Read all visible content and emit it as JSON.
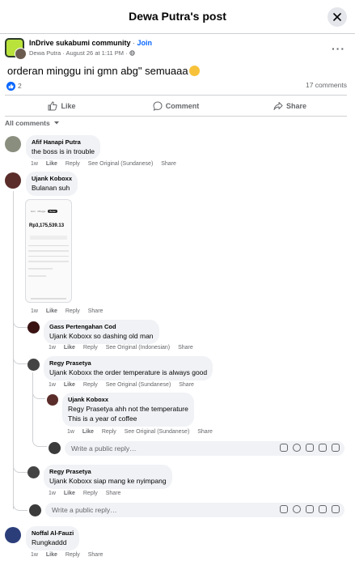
{
  "header": {
    "title": "Dewa Putra's post"
  },
  "post": {
    "group_name": "InDrive sukabumi community",
    "join_label": "Join",
    "author": "Dewa Putra",
    "timestamp": "August 26 at 1:11 PM",
    "text": "orderan minggu ini gmn abg\" semuaaa",
    "like_count": "2",
    "comment_count": "17 comments"
  },
  "actions": {
    "like": "Like",
    "comment": "Comment",
    "share": "Share"
  },
  "sort_label": "All comments",
  "comment_actions": {
    "like": "Like",
    "reply": "Reply",
    "share": "Share",
    "see_original_sundanese": "See Original (Sundanese)",
    "see_original_indonesian": "See Original (Indonesian)"
  },
  "comments": [
    {
      "author": "Afif Hanapi Putra",
      "text": "the boss is in trouble",
      "time": "1w"
    },
    {
      "author": "Ujank Koboxx",
      "text": "Bulanan suh",
      "time": "1w",
      "photo": {
        "tabs": [
          "Hari",
          "Minggu",
          "Bulan"
        ],
        "amount": "Rp3,175,539.13"
      }
    },
    {
      "author": "Gass Pertengahan Cod",
      "text": "Ujank Koboxx so dashing old man",
      "time": "1w"
    },
    {
      "author": "Regy Prasetya",
      "text": "Ujank Koboxx the order temperature is always good",
      "time": "1w"
    },
    {
      "author": "Ujank Koboxx",
      "text1": "Regy Prasetya ahh not the temperature",
      "text2": "This is a year of coffee",
      "time": "1w"
    },
    {
      "author": "Regy Prasetya",
      "text": "Ujank Koboxx siap mang ke nyimpang",
      "time": "1w"
    },
    {
      "author": "Noffal Al-Fauzi",
      "text": "Rungkaddd",
      "time": "1w"
    }
  ],
  "reply_placeholder": "Write a public reply…",
  "colors": {
    "accent": "#0866ff",
    "bubble": "#f0f2f5",
    "secondary_text": "#65676b"
  }
}
